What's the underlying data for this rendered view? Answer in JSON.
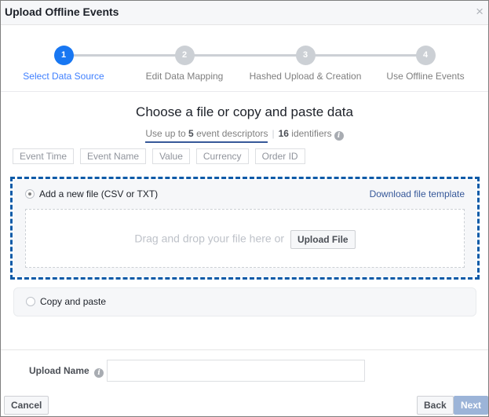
{
  "dialog": {
    "title": "Upload Offline Events",
    "close_icon": "×"
  },
  "stepper": {
    "steps": [
      {
        "number": "1",
        "label": "Select Data Source",
        "state": "active"
      },
      {
        "number": "2",
        "label": "Edit Data Mapping",
        "state": "inactive"
      },
      {
        "number": "3",
        "label": "Hashed Upload & Creation",
        "state": "inactive"
      },
      {
        "number": "4",
        "label": "Use Offline Events",
        "state": "inactive"
      }
    ]
  },
  "main": {
    "heading": "Choose a file or copy and paste data",
    "subline": {
      "prefix": "Use up to ",
      "descriptors_count": "5",
      "descriptors_label": " event descriptors",
      "separator": "|",
      "identifiers_count": "16",
      "identifiers_label": " identifiers",
      "info_icon": "i"
    },
    "descriptor_chips": [
      "Event Time",
      "Event Name",
      "Value",
      "Currency",
      "Order ID"
    ],
    "option_file": {
      "label": "Add a new file (CSV or TXT)",
      "selected": true,
      "download_link": "Download file template",
      "dropzone_text": "Drag and drop your file here or",
      "upload_button": "Upload File"
    },
    "option_paste": {
      "label": "Copy and paste",
      "selected": false
    }
  },
  "footer": {
    "upload_name_label": "Upload Name",
    "upload_name_info_icon": "i",
    "upload_name_value": "",
    "cancel_label": "Cancel",
    "back_label": "Back",
    "next_label": "Next"
  }
}
